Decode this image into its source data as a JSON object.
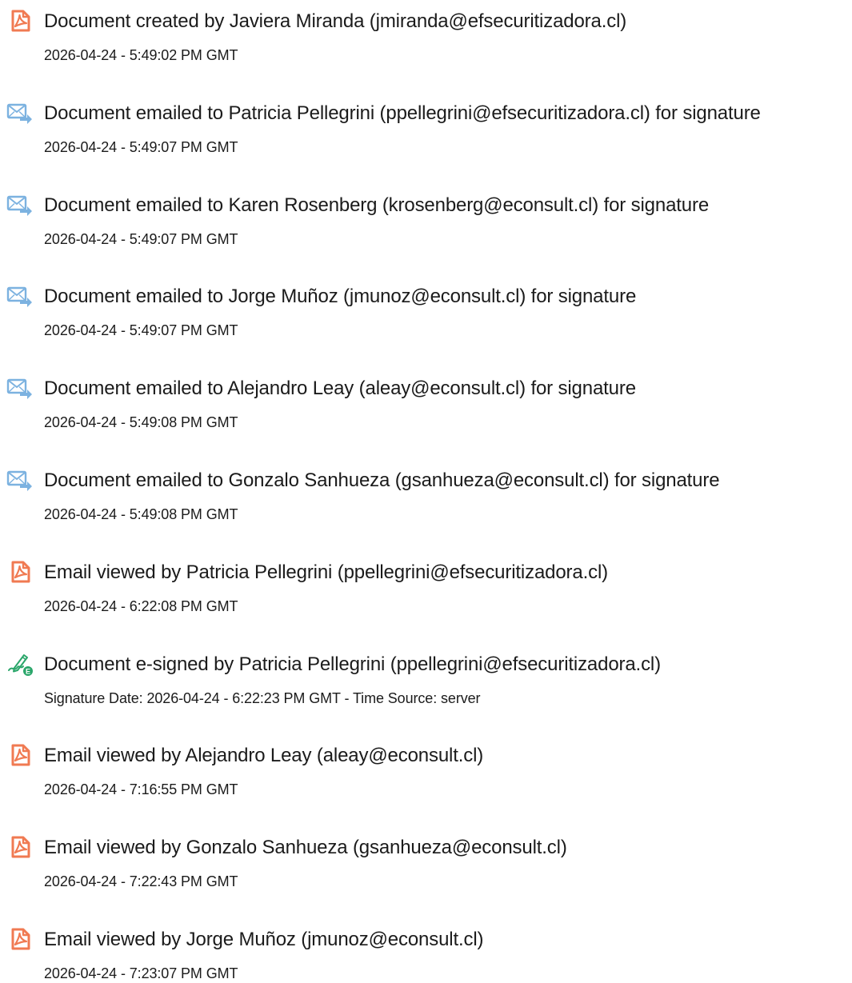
{
  "events": [
    {
      "icon": "acrobat-document-icon",
      "text": "Document created by Javiera Miranda (jmiranda@efsecuritizadora.cl)",
      "date": "2026-04-24 - 5:49:02 PM GMT"
    },
    {
      "icon": "email-sent-icon",
      "text": "Document emailed to Patricia Pellegrini (ppellegrini@efsecuritizadora.cl) for signature",
      "date": "2026-04-24 - 5:49:07 PM GMT"
    },
    {
      "icon": "email-sent-icon",
      "text": "Document emailed to Karen Rosenberg (krosenberg@econsult.cl) for signature",
      "date": "2026-04-24 - 5:49:07 PM GMT"
    },
    {
      "icon": "email-sent-icon",
      "text": "Document emailed to Jorge Muñoz (jmunoz@econsult.cl) for signature",
      "date": "2026-04-24 - 5:49:07 PM GMT"
    },
    {
      "icon": "email-sent-icon",
      "text": "Document emailed to Alejandro Leay (aleay@econsult.cl) for signature",
      "date": "2026-04-24 - 5:49:08 PM GMT"
    },
    {
      "icon": "email-sent-icon",
      "text": "Document emailed to Gonzalo Sanhueza (gsanhueza@econsult.cl) for signature",
      "date": "2026-04-24 - 5:49:08 PM GMT"
    },
    {
      "icon": "acrobat-document-icon",
      "text": "Email viewed by Patricia Pellegrini (ppellegrini@efsecuritizadora.cl)",
      "date": "2026-04-24 - 6:22:08 PM GMT"
    },
    {
      "icon": "e-sign-pen-icon",
      "text": "Document e-signed by Patricia Pellegrini (ppellegrini@efsecuritizadora.cl)",
      "date": "Signature Date: 2026-04-24 - 6:22:23 PM GMT - Time Source: server"
    },
    {
      "icon": "acrobat-document-icon",
      "text": "Email viewed by Alejandro Leay (aleay@econsult.cl)",
      "date": "2026-04-24 - 7:16:55 PM GMT"
    },
    {
      "icon": "acrobat-document-icon",
      "text": "Email viewed by Gonzalo Sanhueza (gsanhueza@econsult.cl)",
      "date": "2026-04-24 - 7:22:43 PM GMT"
    },
    {
      "icon": "acrobat-document-icon",
      "text": "Email viewed by Jorge Muñoz (jmunoz@econsult.cl)",
      "date": "2026-04-24 - 7:23:07 PM GMT"
    }
  ],
  "colors": {
    "document_icon": "#f07a52",
    "email_icon": "#7cb2e0",
    "sign_icon_pen": "#2aa66a",
    "text": "#1b1b1b"
  }
}
